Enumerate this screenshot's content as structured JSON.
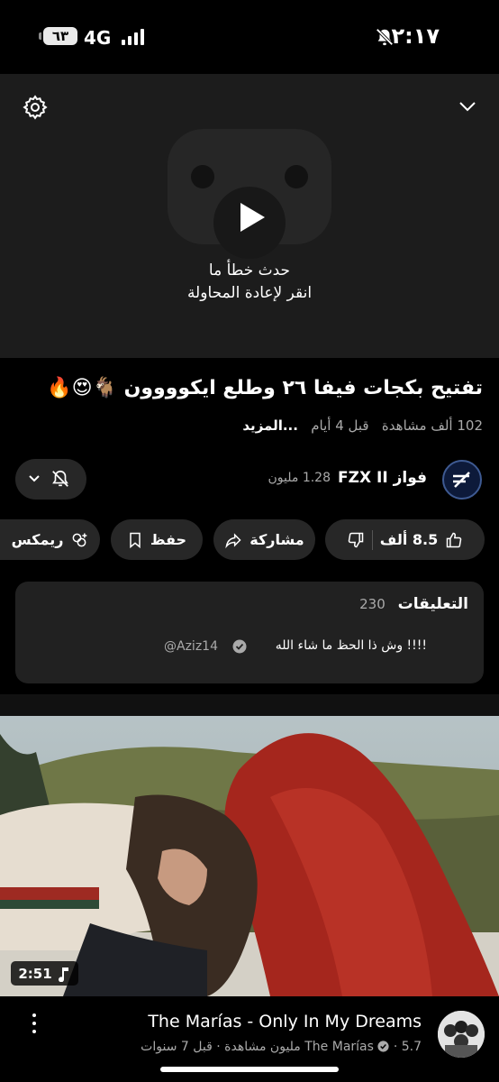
{
  "status": {
    "time": "٢:١٧",
    "network": "4G",
    "battery": "٦٣"
  },
  "player": {
    "error_line1": "حدث خطأ ما",
    "error_line2": "انقر لإعادة المحاولة"
  },
  "video": {
    "title": "تفتيح بكجات فيفا ٢٦ وطلع ايكوووون 🐐😍🔥",
    "views": "102 ألف مشاهدة",
    "age": "قبل 4 أيام",
    "more": "...المزيد"
  },
  "channel": {
    "name": "فواز FZX II",
    "subscribers": "1.28 مليون"
  },
  "actions": {
    "likes": "8.5 ألف",
    "share": "مشاركة",
    "save": "حفظ",
    "remix": "ريمكس"
  },
  "comments": {
    "label": "التعليقات",
    "count": "230",
    "top_user": "@Aziz14",
    "top_text": "!!!! وش ذا الحظ ما شاء الله"
  },
  "next_video": {
    "duration": "2:51",
    "title": "The Marías - Only In My Dreams",
    "channel": "The Marías",
    "views": "5.7 مليون مشاهدة",
    "age": "قبل 7 سنوات"
  }
}
